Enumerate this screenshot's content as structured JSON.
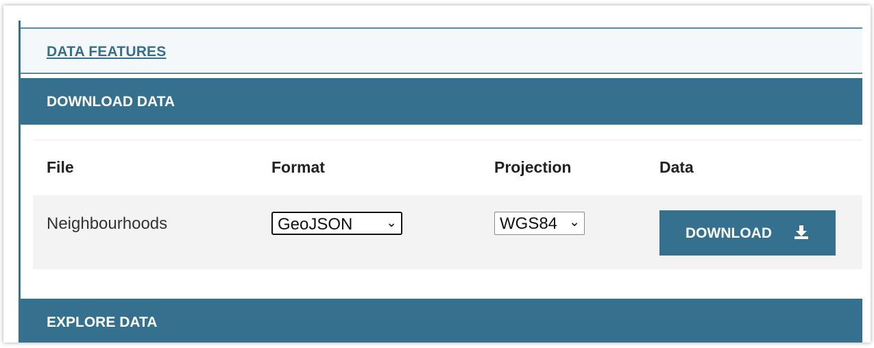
{
  "sections": {
    "features_link": "DATA FEATURES",
    "download_title": "DOWNLOAD DATA",
    "explore_title": "EXPLORE DATA"
  },
  "table": {
    "headers": [
      "File",
      "Format",
      "Projection",
      "Data"
    ],
    "row": {
      "file": "Neighbourhoods",
      "format": "GeoJSON",
      "projection": "WGS84",
      "button_label": "DOWNLOAD",
      "button_icon": "download-icon"
    }
  },
  "colors": {
    "accent": "#35718f",
    "link": "#3a6f8a"
  }
}
